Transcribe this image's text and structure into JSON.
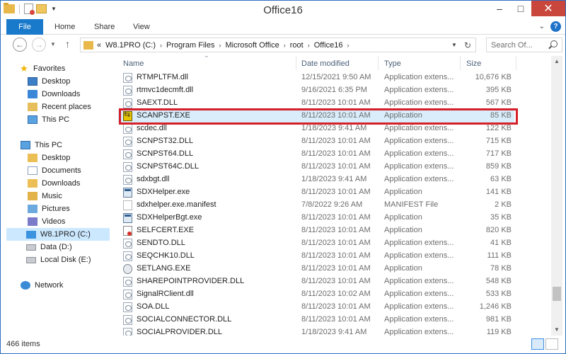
{
  "window": {
    "title": "Office16",
    "minimize": "–",
    "maximize": "□",
    "close": "✕"
  },
  "ribbon": {
    "tabs": [
      "File",
      "Home",
      "Share",
      "View"
    ],
    "help": "?"
  },
  "address": {
    "prefix": "«",
    "crumbs": [
      "W8.1PRO (C:)",
      "Program Files",
      "Microsoft Office",
      "root",
      "Office16"
    ],
    "search_placeholder": "Search Of..."
  },
  "navpane": {
    "favorites_label": "Favorites",
    "favorites": [
      "Desktop",
      "Downloads",
      "Recent places"
    ],
    "thispc_label": "This PC",
    "thispc": [
      "This PC",
      "Desktop",
      "Documents",
      "Downloads",
      "Music",
      "Pictures",
      "Videos"
    ],
    "drives": [
      "W8.1PRO (C:)",
      "Data (D:)",
      "Local Disk (E:)"
    ],
    "network": "Network"
  },
  "columns": {
    "name": "Name",
    "date": "Date modified",
    "type": "Type",
    "size": "Size"
  },
  "files": [
    {
      "name": "RTMPLTFM.dll",
      "date": "12/15/2021 9:50 AM",
      "type": "Application extens...",
      "size": "10,676 KB",
      "icon": "dll"
    },
    {
      "name": "rtmvc1decmft.dll",
      "date": "9/16/2021 6:35 PM",
      "type": "Application extens...",
      "size": "395 KB",
      "icon": "dll"
    },
    {
      "name": "SAEXT.DLL",
      "date": "8/11/2023 10:01 AM",
      "type": "Application extens...",
      "size": "567 KB",
      "icon": "dll"
    },
    {
      "name": "SCANPST.EXE",
      "date": "8/11/2023 10:01 AM",
      "type": "Application",
      "size": "85 KB",
      "icon": "scan"
    },
    {
      "name": "scdec.dll",
      "date": "1/18/2023 9:41 AM",
      "type": "Application extens...",
      "size": "122 KB",
      "icon": "dll"
    },
    {
      "name": "SCNPST32.DLL",
      "date": "8/11/2023 10:01 AM",
      "type": "Application extens...",
      "size": "715 KB",
      "icon": "dll"
    },
    {
      "name": "SCNPST64.DLL",
      "date": "8/11/2023 10:01 AM",
      "type": "Application extens...",
      "size": "717 KB",
      "icon": "dll"
    },
    {
      "name": "SCNPST64C.DLL",
      "date": "8/11/2023 10:01 AM",
      "type": "Application extens...",
      "size": "859 KB",
      "icon": "dll"
    },
    {
      "name": "sdxbgt.dll",
      "date": "1/18/2023 9:41 AM",
      "type": "Application extens...",
      "size": "63 KB",
      "icon": "dll"
    },
    {
      "name": "SDXHelper.exe",
      "date": "8/11/2023 10:01 AM",
      "type": "Application",
      "size": "141 KB",
      "icon": "exe"
    },
    {
      "name": "sdxhelper.exe.manifest",
      "date": "7/8/2022 9:26 AM",
      "type": "MANIFEST File",
      "size": "2 KB",
      "icon": "manifest"
    },
    {
      "name": "SDXHelperBgt.exe",
      "date": "8/11/2023 10:01 AM",
      "type": "Application",
      "size": "35 KB",
      "icon": "exe"
    },
    {
      "name": "SELFCERT.EXE",
      "date": "8/11/2023 10:01 AM",
      "type": "Application",
      "size": "820 KB",
      "icon": "cert"
    },
    {
      "name": "SENDTO.DLL",
      "date": "8/11/2023 10:01 AM",
      "type": "Application extens...",
      "size": "41 KB",
      "icon": "dll"
    },
    {
      "name": "SEQCHK10.DLL",
      "date": "8/11/2023 10:01 AM",
      "type": "Application extens...",
      "size": "111 KB",
      "icon": "dll"
    },
    {
      "name": "SETLANG.EXE",
      "date": "8/11/2023 10:01 AM",
      "type": "Application",
      "size": "78 KB",
      "icon": "lang"
    },
    {
      "name": "SHAREPOINTPROVIDER.DLL",
      "date": "8/11/2023 10:01 AM",
      "type": "Application extens...",
      "size": "548 KB",
      "icon": "dll"
    },
    {
      "name": "SignalRClient.dll",
      "date": "8/11/2023 10:02 AM",
      "type": "Application extens...",
      "size": "533 KB",
      "icon": "dll"
    },
    {
      "name": "SOA.DLL",
      "date": "8/11/2023 10:01 AM",
      "type": "Application extens...",
      "size": "1,246 KB",
      "icon": "dll"
    },
    {
      "name": "SOCIALCONNECTOR.DLL",
      "date": "8/11/2023 10:01 AM",
      "type": "Application extens...",
      "size": "981 KB",
      "icon": "dll"
    },
    {
      "name": "SOCIALPROVIDER.DLL",
      "date": "1/18/2023 9:41 AM",
      "type": "Application extens...",
      "size": "119 KB",
      "icon": "dll"
    }
  ],
  "status": {
    "item_count": "466 items"
  },
  "colors": {
    "accent": "#1979ca",
    "highlight_border": "#d5202a",
    "close_button": "#c9463d"
  }
}
